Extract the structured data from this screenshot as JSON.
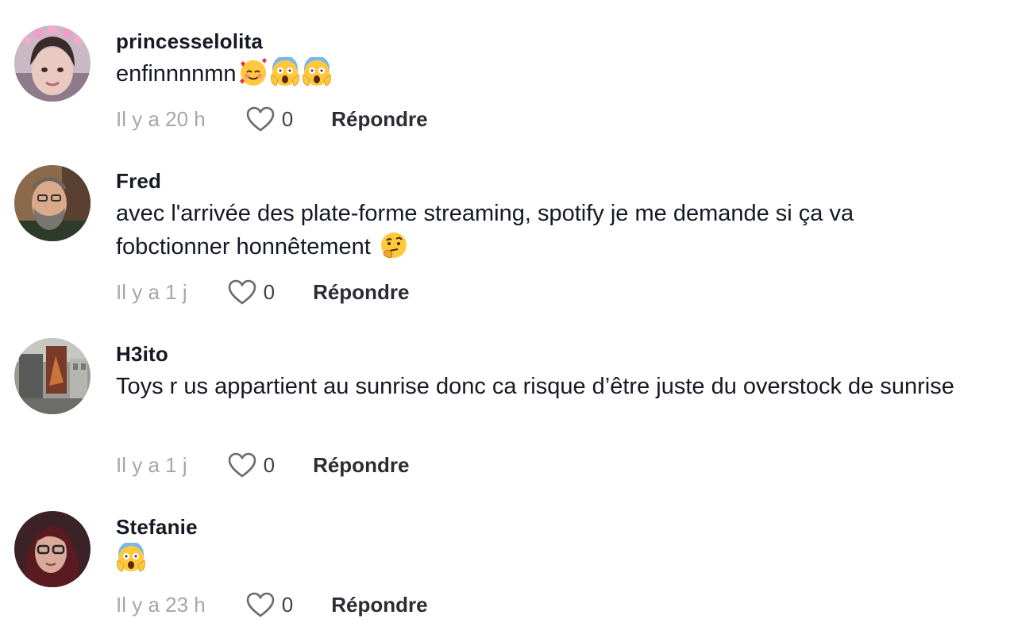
{
  "colors": {
    "text": "#161823",
    "muted": "#a6a7ab",
    "reply": "#2c2c33"
  },
  "comments": [
    {
      "username": "princesselolita",
      "text": "enfinnnnmn",
      "emojis": [
        "smiling-face-with-hearts",
        "face-screaming-in-fear",
        "face-screaming-in-fear"
      ],
      "time": "Il y a 20 h",
      "likes": "0",
      "reply_label": "Répondre",
      "avatar_icon": "avatar-woman-flower-crown"
    },
    {
      "username": "Fred",
      "text": "avec l'arrivée des plate-forme streaming, spotify je me demande si ça va fobctionner honnêtement",
      "emojis": [
        "thinking-face"
      ],
      "time": "Il y a 1 j",
      "likes": "0",
      "reply_label": "Répondre",
      "avatar_icon": "avatar-bearded-man"
    },
    {
      "username": "H3ito",
      "text": "Toys r us appartient au sunrise donc ca risque d’être juste du overstock de sunrise",
      "emojis": [],
      "time": "Il y a 1 j",
      "likes": "0",
      "reply_label": "Répondre",
      "avatar_icon": "avatar-store-photo"
    },
    {
      "username": "Stefanie",
      "text": "",
      "emojis": [
        "face-screaming-in-fear"
      ],
      "time": "Il y a 23 h",
      "likes": "0",
      "reply_label": "Répondre",
      "avatar_icon": "avatar-woman-glasses"
    }
  ]
}
